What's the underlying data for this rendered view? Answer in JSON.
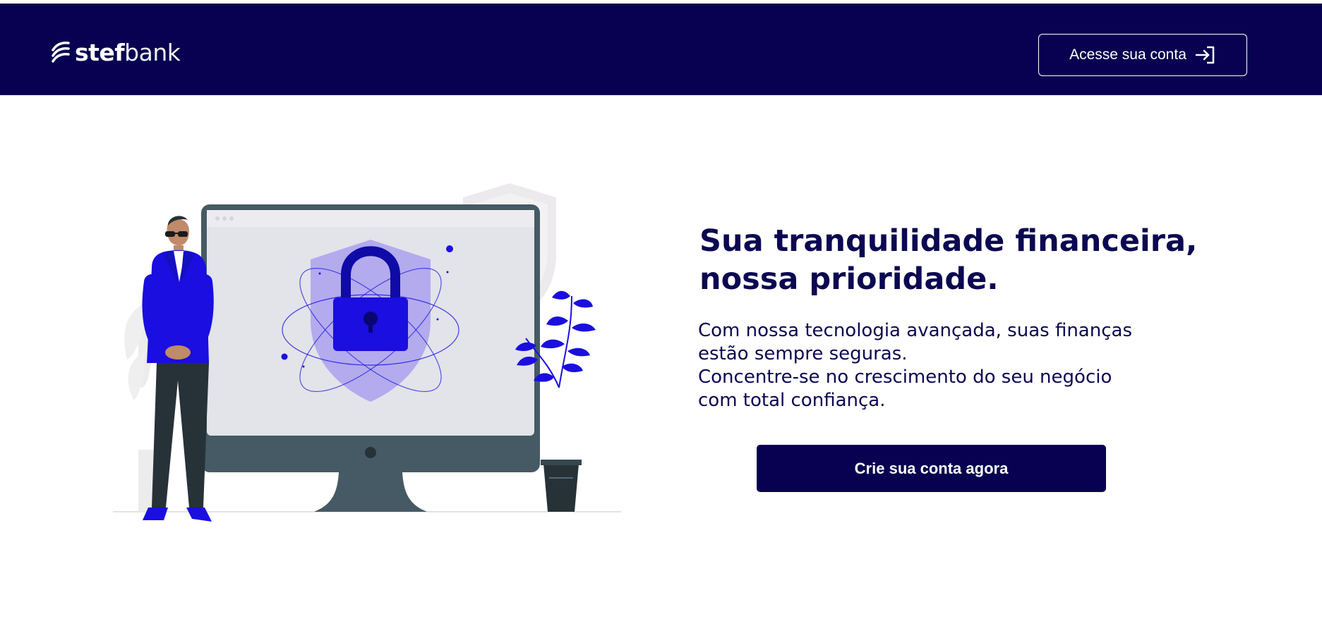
{
  "header": {
    "logo": {
      "bold": "stef",
      "light": "bank",
      "icon": "stefbank-swoosh-icon"
    },
    "login_button": {
      "label": "Acesse sua conta",
      "icon": "login-arrow-icon"
    }
  },
  "hero": {
    "headline_line1": "Sua tranquilidade financeira,",
    "headline_line2": "nossa prioridade.",
    "body_line1": "Com nossa tecnologia avançada, suas finanças",
    "body_line2": "estão sempre seguras.",
    "body_line3": "Concentre-se no crescimento do seu negócio",
    "body_line4": "com total confiança.",
    "cta_label": "Crie sua conta agora",
    "illustration": "security-guard-monitor-lock-illustration"
  },
  "colors": {
    "brand_navy": "#080050",
    "accent_blue": "#1a0ee0",
    "text_navy": "#0b0751"
  }
}
